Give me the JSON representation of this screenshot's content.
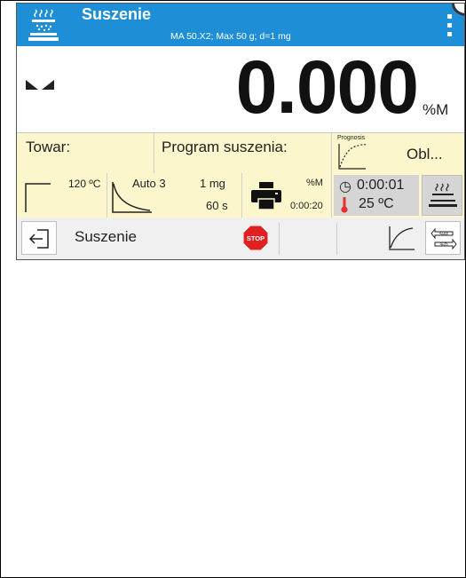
{
  "header": {
    "title": "Suszenie",
    "subtitle": "MA 50.X2; Max 50 g; d=1 mg"
  },
  "display": {
    "weight_value": "0.000",
    "unit": "%M"
  },
  "info_row": {
    "product_label": "Towar:",
    "program_label": "Program suszenia:",
    "prognosis_caption": "Prognosis",
    "prognosis_value": "Obl..."
  },
  "params": {
    "temperature": "120 ºC",
    "mode": "Auto 3",
    "mass_threshold": "1 mg",
    "time_interval": "60 s",
    "print_unit": "%M",
    "print_interval": "0:00:20",
    "elapsed_time": "0:00:01",
    "chamber_temp": "25 ºC"
  },
  "bottom_bar": {
    "label": "Suszenie",
    "stop_text": "STOP",
    "unit_switch_top": "%M",
    "unit_switch_bottom": "%D"
  },
  "colors": {
    "header": "#1e8fd6",
    "panel": "#fbf6cb",
    "stop": "#e02020",
    "thermometer": "#e53030"
  }
}
